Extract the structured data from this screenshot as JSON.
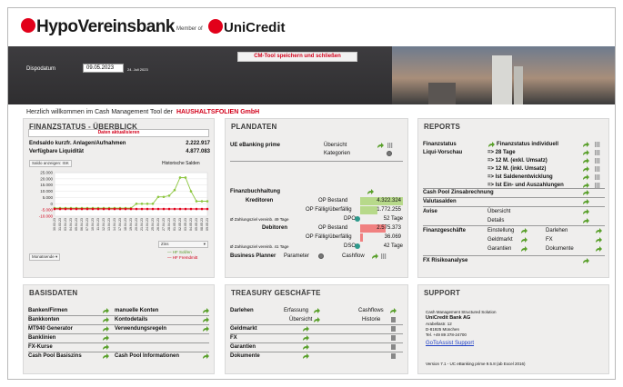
{
  "header": {
    "brand": "HypoVereinsbank",
    "member_of": "Member of",
    "unicredit": "UniCredit",
    "cm_tool_button": "CM-Tool speichern und schließen",
    "dispodatum_label": "Dispodatum",
    "dispodatum_value": "09.05.2023",
    "dispodatum_sub": "24. Juli 2023"
  },
  "welcome": {
    "text": "Herzlich willkommen im Cash Management Tool der",
    "firm": "HAUSHALTSFOLIEN GmbH"
  },
  "finanzstatus": {
    "title": "FINANZSTATUS - ÜBERBLICK",
    "refresh_label": "Daten aktualisieren",
    "row1_label": "Endsaldo kurzfr. Anlagen/Aufnahmen",
    "row1_value": "2.222.917",
    "row2_label": "Verfügbare Liquidität",
    "row2_value": "4.877.083",
    "saldo_button": "Saldo anzeigen: ISK",
    "historische": "Historische Salden",
    "select_value": "Zins",
    "monatsende": "Monatsende",
    "legend": [
      "HF Soll/en",
      "HF Fremdmitt"
    ],
    "colors": {
      "green": "#8dc63f",
      "red": "#e2001a"
    }
  },
  "chart_data": {
    "type": "line",
    "title": "",
    "xlabel": "",
    "ylabel": "",
    "ylim": [
      -10000,
      25000
    ],
    "y_ticks": [
      "25.000",
      "20.000",
      "15.000",
      "10.000",
      "5.000",
      "0",
      "-5.000",
      "-10.000"
    ],
    "x": [
      "30.03.23",
      "31.03.23",
      "03.04.23",
      "04.04.23",
      "05.04.23",
      "06.04.23",
      "07.04.23",
      "10.04.23",
      "11.04.23",
      "12.04.23",
      "13.04.23",
      "14.04.23",
      "17.04.23",
      "18.04.23",
      "19.04.23",
      "20.04.23",
      "21.04.23",
      "24.04.23",
      "25.04.23",
      "26.04.23",
      "27.04.23",
      "28.04.23",
      "01.05.23",
      "02.05.23",
      "03.05.23",
      "04.05.23",
      "05.05.23",
      "08.05.23",
      "09.05.23"
    ],
    "series": [
      {
        "name": "HF Soll/en",
        "color": "#8dc63f",
        "values": [
          -3500,
          -3500,
          -3500,
          -3500,
          -3500,
          -3500,
          -3500,
          -3500,
          -3500,
          -3500,
          -3500,
          -3500,
          -3500,
          -3500,
          -3500,
          0,
          0,
          0,
          0,
          5500,
          5500,
          6500,
          11000,
          21000,
          21000,
          10000,
          2000,
          2000,
          2000
        ]
      },
      {
        "name": "HF Fremdmitt",
        "color": "#e2001a",
        "values": [
          -4200,
          -4200,
          -4200,
          -4200,
          -4200,
          -4200,
          -4200,
          -4200,
          -4200,
          -4200,
          -4200,
          -4200,
          -4200,
          -4200,
          -4200,
          -4200,
          -4200,
          -4200,
          -4200,
          -4200,
          -4200,
          -4200,
          -4200,
          -4200,
          -4200,
          -4200,
          -4200,
          -4200,
          -4200
        ]
      }
    ],
    "legend": "bottom-right"
  },
  "plandaten": {
    "title": "PLANDATEN",
    "ebanking_label": "UE eBanking prime",
    "uebersicht": "Übersicht",
    "kategorien": "Kategorien",
    "finanzbuch": "Finanzbuchhaltung",
    "kreditoren": "Kreditoren",
    "op_bestand": "OP Bestand",
    "kreditoren_bestand": "4.322.324",
    "op_faellig": "OP Fällig/überfällig",
    "kreditoren_faellig": "1.772.255",
    "zahlungsziel_k": "Ø Zahlungsziel vereinb. 49 Tage",
    "dpo": "DPO",
    "dpo_value": "52 Tage",
    "debitoren": "Debitoren",
    "debitoren_bestand": "2.575.373",
    "debitoren_faellig": "36.069",
    "zahlungsziel_d": "Ø Zahlungsziel vereinb. 41 Tage",
    "dso": "DSO",
    "dso_value": "42 Tage",
    "business_planner": "Business Planner",
    "parameter": "Parameter",
    "cashflow": "Cashflow"
  },
  "reports": {
    "title": "REPORTS",
    "finanzstatus": "Finanzstatus",
    "finanzstatus_individuell": "Finanzstatus individuell",
    "liqui_vorschau": "Liqui-Vorschau",
    "liqui_items": [
      "=> 28 Tage",
      "=> 12 M. (exkl. Umsatz)",
      "=> 12 M. (inkl. Umsatz)",
      "=> Ist Saldenentwicklung",
      "=> Ist Ein- und Auszahlungen"
    ],
    "cash_pool": "Cash Pool Zinsabrechnung",
    "valutasalden": "Valutasalden",
    "avise": "Avise",
    "avise_items": [
      "Übersicht",
      "Details"
    ],
    "finanzgeschaefte": "Finanzgeschäfte",
    "fg_col1": [
      "Einstellung",
      "Geldmarkt",
      "Garantien"
    ],
    "fg_col2": [
      "Darlehen",
      "FX",
      "Dokumente"
    ],
    "fx_risiko": "FX Risikoanalyse"
  },
  "basisdaten": {
    "title": "BASISDATEN",
    "col1": [
      "Banken/Firmen",
      "Bankkonten",
      "MT940 Generator",
      "Banklinien",
      "FX-Kurse",
      "Cash Pool Basiszins"
    ],
    "col2": [
      "manuelle Konten",
      "Kontodetails",
      "Verwendungsregeln",
      "",
      "",
      "Cash Pool Informationen"
    ]
  },
  "treasury": {
    "title": "TREASURY GESCHÄFTE",
    "darlehen": "Darlehen",
    "erfassung": "Erfassung",
    "uebersicht": "Übersicht",
    "cashflows": "Cashflows",
    "historie": "Historie",
    "rows": [
      "Geldmarkt",
      "FX",
      "Garantien",
      "Dokumente"
    ]
  },
  "support": {
    "title": "SUPPORT",
    "line1": "Cash Management Structured Solution",
    "company": "UniCredit Bank AG",
    "street": "Arabellastr. 12",
    "city": "D-81925 München",
    "phone": "Tel. +49 89 378-24700",
    "link": "GoToAssist Support",
    "version": "Version 7.1 - UC eBanking prime 9.5.8 (ab Excel 2016)"
  }
}
